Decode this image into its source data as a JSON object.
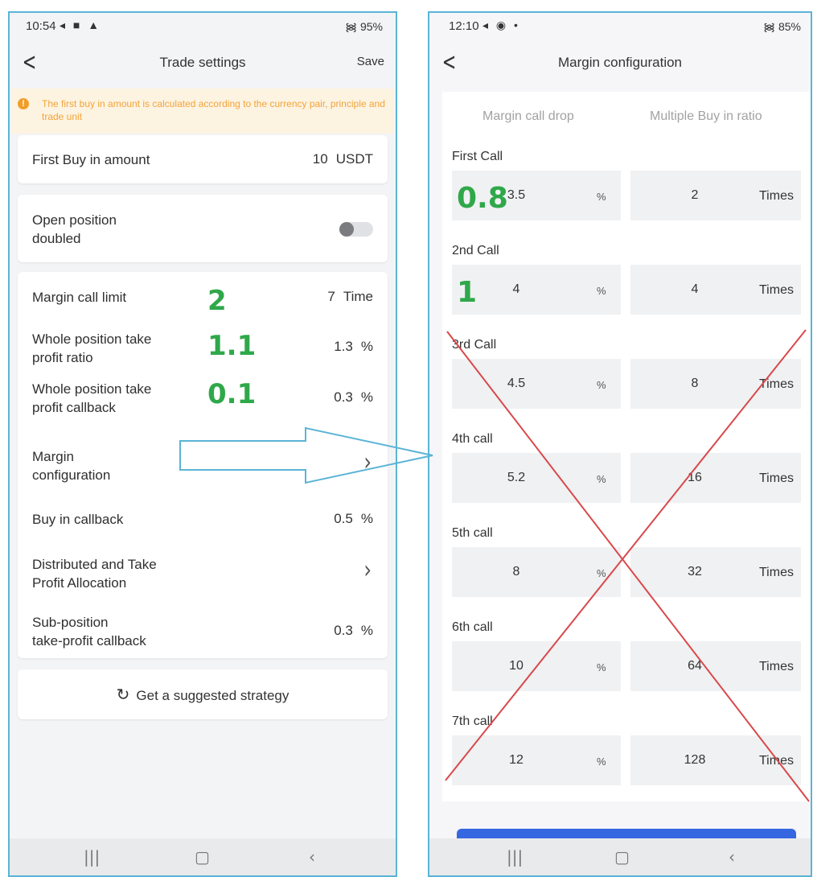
{
  "left": {
    "status": {
      "time": "10:54",
      "icons": "◂ ■ ▲",
      "battery": "95%"
    },
    "header": {
      "title": "Trade settings",
      "save_label": "Save"
    },
    "notice": "The first buy in amount is calculated according to the currency pair, principle and trade unit",
    "first_buy": {
      "label": "First Buy in amount",
      "value": "10",
      "unit": "USDT"
    },
    "open_position": {
      "label_line1": "Open position",
      "label_line2": "doubled",
      "toggle_on": false
    },
    "settings": {
      "margin_call_limit": {
        "label": "Margin call limit",
        "value": "7",
        "unit": "Time",
        "annotation": "2"
      },
      "take_profit_ratio": {
        "label_line1": "Whole position take",
        "label_line2": "profit ratio",
        "value": "1.3",
        "unit": "%",
        "annotation": "1.1"
      },
      "take_profit_callback": {
        "label_line1": "Whole position take",
        "label_line2": "profit callback",
        "value": "0.3",
        "unit": "%",
        "annotation": "0.1"
      },
      "margin_configuration": {
        "label_line1": "Margin",
        "label_line2": "configuration"
      },
      "buy_in_callback": {
        "label": "Buy in callback",
        "value": "0.5",
        "unit": "%"
      },
      "distributed": {
        "label_line1": "Distributed and Take",
        "label_line2": "Profit Allocation"
      },
      "sub_position": {
        "label_line1": "Sub-position",
        "label_line2": "take-profit callback",
        "value": "0.3",
        "unit": "%"
      }
    },
    "strategy_button": "Get a suggested strategy"
  },
  "right": {
    "status": {
      "time": "12:10",
      "icons": "◂ ◉   •",
      "battery": "85%"
    },
    "header": {
      "title": "Margin configuration"
    },
    "columns": {
      "drop": "Margin call drop",
      "ratio": "Multiple Buy in ratio"
    },
    "percent_unit": "%",
    "times_unit": "Times",
    "calls": [
      {
        "label": "First Call",
        "drop": "3.5",
        "ratio": "2",
        "annotation": "0.8"
      },
      {
        "label": "2nd Call",
        "drop": "4",
        "ratio": "4",
        "annotation": "1"
      },
      {
        "label": "3rd Call",
        "drop": "4.5",
        "ratio": "8"
      },
      {
        "label": "4th call",
        "drop": "5.2",
        "ratio": "16"
      },
      {
        "label": "5th call",
        "drop": "8",
        "ratio": "32"
      },
      {
        "label": "6th call",
        "drop": "10",
        "ratio": "64"
      },
      {
        "label": "7th call",
        "drop": "12",
        "ratio": "128"
      }
    ]
  },
  "colors": {
    "annotation": "#2fa84a",
    "cross": "#d9494b",
    "arrow": "#5bb4d6",
    "accent": "#3567e0",
    "notice_text": "#f2a43a"
  }
}
